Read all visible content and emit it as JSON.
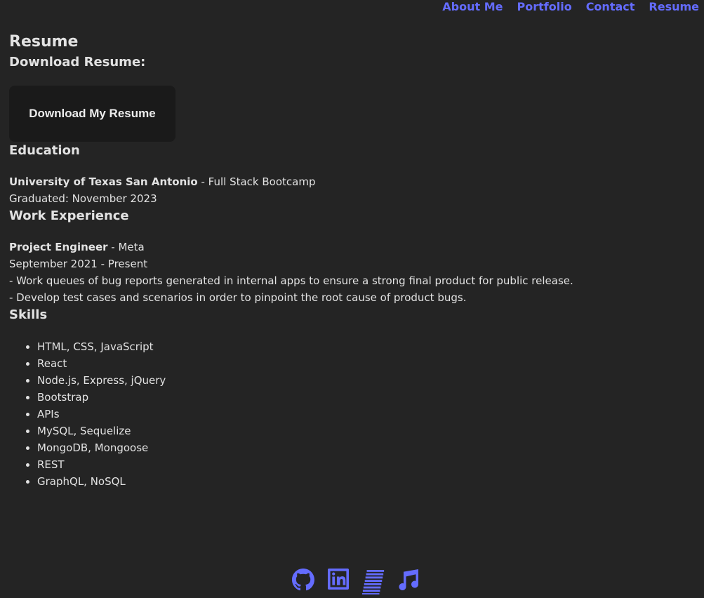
{
  "nav": {
    "items": [
      {
        "label": "About Me"
      },
      {
        "label": "Portfolio"
      },
      {
        "label": "Contact"
      },
      {
        "label": "Resume"
      }
    ]
  },
  "page": {
    "title": "Resume"
  },
  "download": {
    "heading": "Download Resume:",
    "button_label": "Download My Resume"
  },
  "education": {
    "heading": "Education",
    "school": "University of Texas San Antonio",
    "program": " - Full Stack Bootcamp",
    "graduated": "Graduated: November 2023"
  },
  "work": {
    "heading": "Work Experience",
    "title": "Project Engineer",
    "company": " - Meta",
    "dates": "September 2021 - Present",
    "bullets": [
      "- Work queues of bug reports generated in internal apps to ensure a strong final product for public release.",
      "- Develop test cases and scenarios in order to pinpoint the root cause of product bugs."
    ]
  },
  "skills": {
    "heading": "Skills",
    "items": [
      "HTML, CSS, JavaScript",
      "React",
      "Node.js, Express, jQuery",
      "Bootstrap",
      "APIs",
      "MySQL, Sequelize",
      "MongoDB, Mongoose",
      "REST",
      "GraphQL, NoSQL"
    ]
  },
  "footer": {
    "icons": [
      "github-icon",
      "linkedin-icon",
      "resume-lines-icon",
      "music-note-icon"
    ]
  },
  "colors": {
    "background": "#242424",
    "accent": "#646cff",
    "button_bg": "#1a1a1a"
  }
}
